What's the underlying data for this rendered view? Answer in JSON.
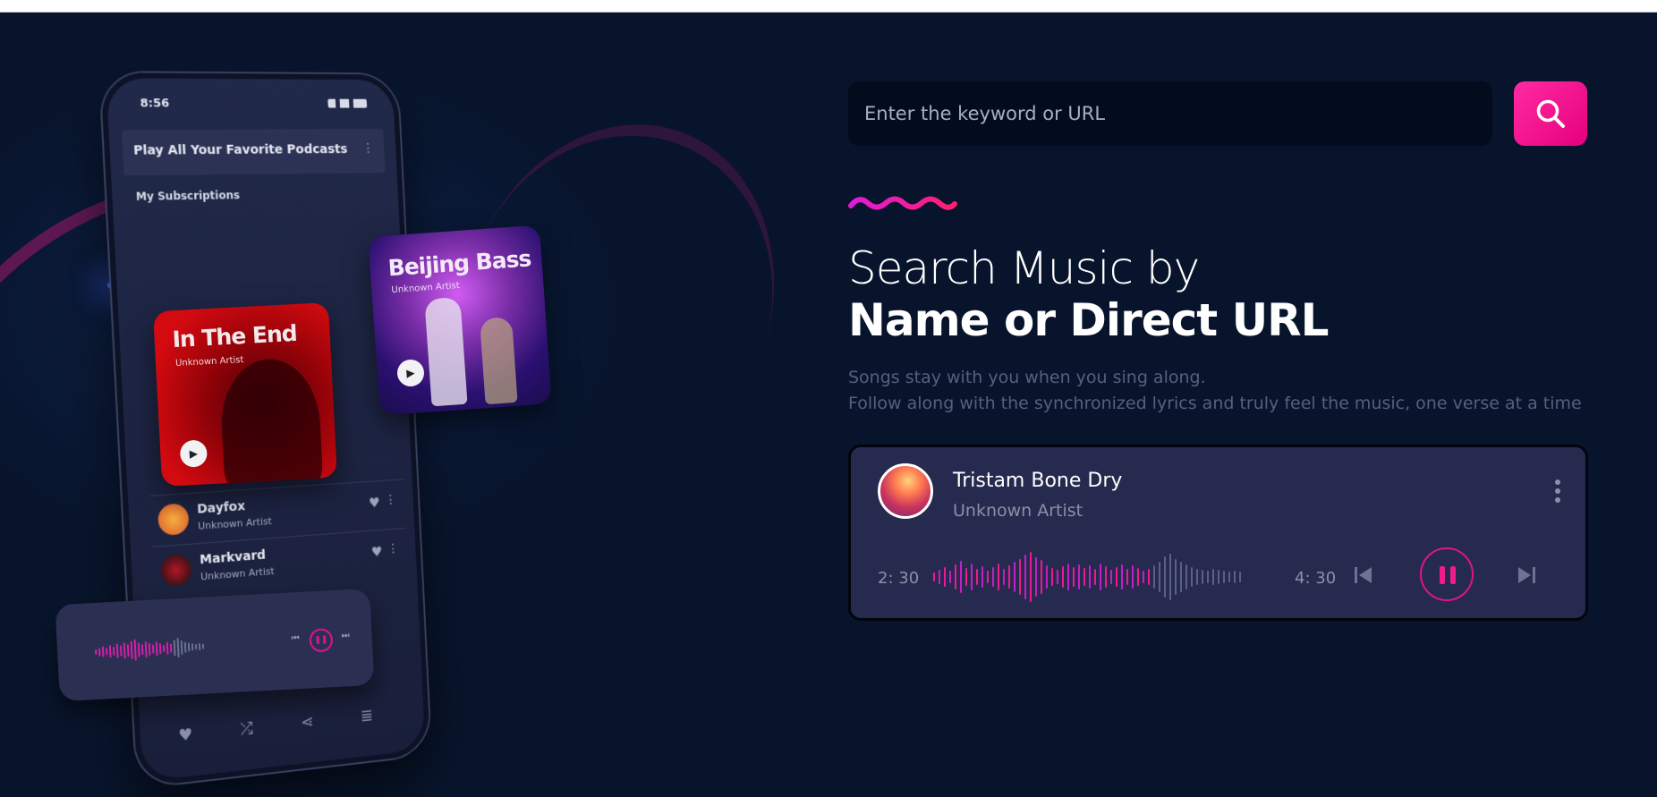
{
  "phone": {
    "time": "8:56",
    "header_title": "Play All Your Favorite Podcasts",
    "subscriptions_label": "My Subscriptions",
    "rows": [
      {
        "name": "Dayfox",
        "artist": "Unknown Artist"
      },
      {
        "name": "Markvard",
        "artist": "Unknown Artist"
      }
    ],
    "cards": [
      {
        "title": "In The End",
        "artist": "Unknown Artist"
      },
      {
        "title": "Beijing Bass",
        "artist": "Unknown Artist"
      }
    ]
  },
  "search": {
    "placeholder": "Enter the keyword or URL",
    "button_icon": "search-icon"
  },
  "hero": {
    "heading_line1": "Search Music by",
    "heading_line2": "Name or Direct URL",
    "lead_line1": "Songs stay with you when you sing along.",
    "lead_line2": "Follow along with the synchronized lyrics and truly feel the music, one verse at a time"
  },
  "player": {
    "title": "Tristam Bone Dry",
    "artist": "Unknown Artist",
    "current_time": "2: 30",
    "total_time": "4: 30",
    "progress": 0.7,
    "state": "playing",
    "icons": {
      "menu": "more-vertical-icon",
      "prev": "skip-previous-icon",
      "play": "pause-icon",
      "next": "skip-next-icon"
    }
  },
  "colors": {
    "background": "#07142b",
    "accent": "#e6007e",
    "player_bg": "#262a4f"
  }
}
